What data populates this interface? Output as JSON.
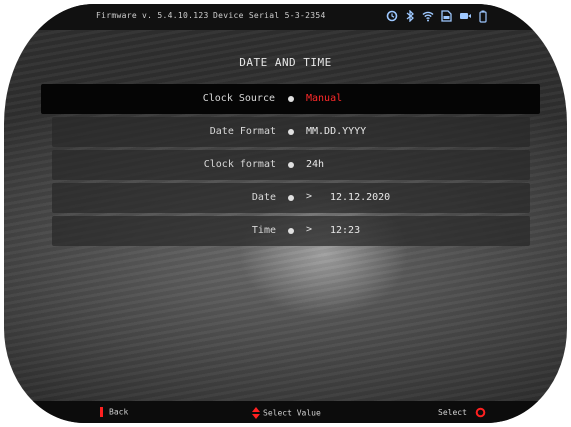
{
  "status": {
    "firmware": "Firmware v. 5.4.10.123",
    "serial": "Device Serial 5-3-2354",
    "icons": [
      "timer-icon",
      "bluetooth-icon",
      "wifi-icon",
      "sd-card-icon",
      "video-icon",
      "battery-icon"
    ]
  },
  "page": {
    "title": "DATE AND TIME"
  },
  "rows": [
    {
      "label": "Clock Source",
      "value": "Manual",
      "arrow": ""
    },
    {
      "label": "Date Format",
      "value": "MM.DD.YYYY",
      "arrow": ""
    },
    {
      "label": "Clock format",
      "value": "24h",
      "arrow": ""
    },
    {
      "label": "Date",
      "value": "12.12.2020",
      "arrow": ">"
    },
    {
      "label": "Time",
      "value": "12:23",
      "arrow": ">"
    }
  ],
  "footer": {
    "back": "Back",
    "select_value": "Select Value",
    "select": "Select"
  },
  "colors": {
    "accent": "#ff2020",
    "selected_value": "#ff2a2a"
  }
}
